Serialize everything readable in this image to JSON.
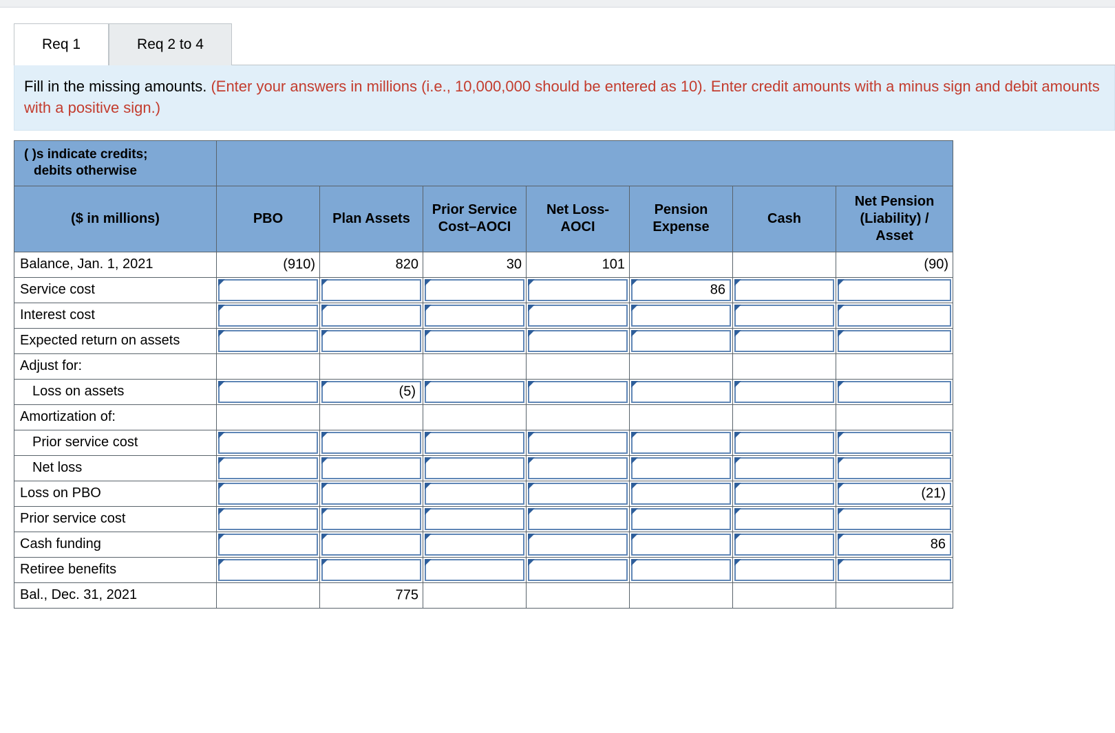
{
  "tabs": {
    "t1": "Req 1",
    "t2": "Req 2 to 4"
  },
  "instruction": {
    "lead": "Fill in the missing amounts. ",
    "hint": "(Enter your answers in millions (i.e., 10,000,000 should be entered as 10). Enter credit amounts with a minus sign and debit amounts with a positive sign.)"
  },
  "headers": {
    "corner1": "( )s indicate credits;",
    "corner2": "debits otherwise",
    "sub": "($ in millions)",
    "c1": "PBO",
    "c2": "Plan Assets",
    "c3": "Prior Service Cost–AOCI",
    "c4": "Net Loss- AOCI",
    "c5": "Pension Expense",
    "c6": "Cash",
    "c7": "Net Pension (Liability) / Asset"
  },
  "rows": [
    {
      "label": "Balance, Jan. 1, 2021",
      "indent": false,
      "cells": [
        {
          "t": "val",
          "v": "(910)"
        },
        {
          "t": "val",
          "v": "820"
        },
        {
          "t": "val",
          "v": "30"
        },
        {
          "t": "val",
          "v": "101"
        },
        {
          "t": "blank"
        },
        {
          "t": "blank"
        },
        {
          "t": "val",
          "v": "(90)"
        }
      ]
    },
    {
      "label": "Service cost",
      "indent": false,
      "cells": [
        {
          "t": "in"
        },
        {
          "t": "in"
        },
        {
          "t": "in"
        },
        {
          "t": "in"
        },
        {
          "t": "val",
          "v": "86"
        },
        {
          "t": "in"
        },
        {
          "t": "in"
        }
      ]
    },
    {
      "label": "Interest cost",
      "indent": false,
      "cells": [
        {
          "t": "in"
        },
        {
          "t": "in"
        },
        {
          "t": "in"
        },
        {
          "t": "in"
        },
        {
          "t": "in"
        },
        {
          "t": "in"
        },
        {
          "t": "in"
        }
      ]
    },
    {
      "label": "Expected return on assets",
      "indent": false,
      "cells": [
        {
          "t": "in"
        },
        {
          "t": "in"
        },
        {
          "t": "in"
        },
        {
          "t": "in"
        },
        {
          "t": "in"
        },
        {
          "t": "in"
        },
        {
          "t": "in"
        }
      ]
    },
    {
      "label": "Adjust for:",
      "indent": false,
      "cells": [
        {
          "t": "blank"
        },
        {
          "t": "blank"
        },
        {
          "t": "blank"
        },
        {
          "t": "blank"
        },
        {
          "t": "blank"
        },
        {
          "t": "blank"
        },
        {
          "t": "blank"
        }
      ]
    },
    {
      "label": "Loss on assets",
      "indent": true,
      "cells": [
        {
          "t": "in"
        },
        {
          "t": "val",
          "v": "(5)"
        },
        {
          "t": "in"
        },
        {
          "t": "in"
        },
        {
          "t": "in"
        },
        {
          "t": "in"
        },
        {
          "t": "in"
        }
      ]
    },
    {
      "label": "Amortization of:",
      "indent": false,
      "cells": [
        {
          "t": "blank"
        },
        {
          "t": "blank"
        },
        {
          "t": "blank"
        },
        {
          "t": "blank"
        },
        {
          "t": "blank"
        },
        {
          "t": "blank"
        },
        {
          "t": "blank"
        }
      ]
    },
    {
      "label": "Prior service cost",
      "indent": true,
      "cells": [
        {
          "t": "in"
        },
        {
          "t": "in"
        },
        {
          "t": "in"
        },
        {
          "t": "in"
        },
        {
          "t": "in"
        },
        {
          "t": "in"
        },
        {
          "t": "in"
        }
      ]
    },
    {
      "label": "Net loss",
      "indent": true,
      "cells": [
        {
          "t": "in"
        },
        {
          "t": "in"
        },
        {
          "t": "in"
        },
        {
          "t": "in"
        },
        {
          "t": "in"
        },
        {
          "t": "in"
        },
        {
          "t": "in"
        }
      ]
    },
    {
      "label": "Loss on PBO",
      "indent": false,
      "cells": [
        {
          "t": "in"
        },
        {
          "t": "in"
        },
        {
          "t": "in"
        },
        {
          "t": "in"
        },
        {
          "t": "in"
        },
        {
          "t": "in"
        },
        {
          "t": "val",
          "v": "(21)"
        }
      ]
    },
    {
      "label": "Prior service cost",
      "indent": false,
      "cells": [
        {
          "t": "in"
        },
        {
          "t": "in"
        },
        {
          "t": "in"
        },
        {
          "t": "in"
        },
        {
          "t": "in"
        },
        {
          "t": "in"
        },
        {
          "t": "in"
        }
      ]
    },
    {
      "label": "Cash funding",
      "indent": false,
      "cells": [
        {
          "t": "in"
        },
        {
          "t": "in"
        },
        {
          "t": "in"
        },
        {
          "t": "in"
        },
        {
          "t": "in"
        },
        {
          "t": "in"
        },
        {
          "t": "val",
          "v": "86"
        }
      ]
    },
    {
      "label": "Retiree benefits",
      "indent": false,
      "cells": [
        {
          "t": "in"
        },
        {
          "t": "in"
        },
        {
          "t": "in"
        },
        {
          "t": "in"
        },
        {
          "t": "in"
        },
        {
          "t": "in"
        },
        {
          "t": "in"
        }
      ]
    },
    {
      "label": "Bal., Dec. 31, 2021",
      "indent": false,
      "cells": [
        {
          "t": "blank"
        },
        {
          "t": "val",
          "v": "775"
        },
        {
          "t": "blank"
        },
        {
          "t": "blank"
        },
        {
          "t": "blank"
        },
        {
          "t": "blank"
        },
        {
          "t": "blank"
        }
      ]
    }
  ]
}
